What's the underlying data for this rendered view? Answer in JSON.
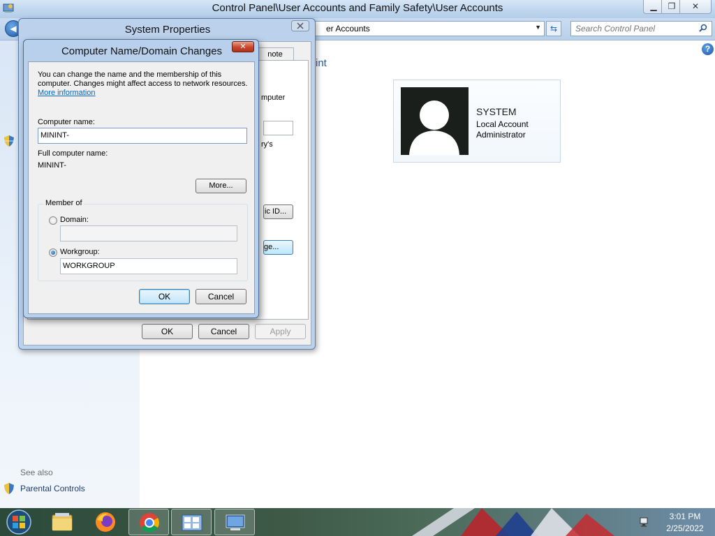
{
  "control_panel": {
    "title": "Control Panel\\User Accounts and Family Safety\\User Accounts",
    "address": "er Accounts",
    "search_placeholder": "Search Control Panel",
    "heading_partial": "int",
    "see_also": "See also",
    "parental_controls": "Parental Controls",
    "user": {
      "name": "SYSTEM",
      "account_type": "Local Account",
      "role": "Administrator"
    }
  },
  "system_properties": {
    "title": "System Properties",
    "tab_remote": "note",
    "text_computer": "mputer",
    "text_rys": "ry's",
    "network_id_button": "ic ID...",
    "change_button": "ge...",
    "ok": "OK",
    "cancel": "Cancel",
    "apply": "Apply"
  },
  "computer_name_dialog": {
    "title": "Computer Name/Domain Changes",
    "description": "You can change the name and the membership of this computer. Changes might affect access to network resources.",
    "more_information": "More information",
    "computer_name_label": "Computer name:",
    "computer_name_value": "MININT-",
    "full_name_label": "Full computer name:",
    "full_name_value": "MININT-",
    "more_button": "More...",
    "member_of_label": "Member of",
    "domain_label": "Domain:",
    "domain_value": "",
    "workgroup_label": "Workgroup:",
    "workgroup_value": "WORKGROUP",
    "selected_membership": "Workgroup",
    "ok": "OK",
    "cancel": "Cancel"
  },
  "taskbar": {
    "items": [
      "Windows Explorer",
      "Firefox",
      "Google Chrome",
      "Control Panel",
      "System Properties"
    ],
    "clock_time": "3:01 PM",
    "clock_date": "2/25/2022"
  },
  "colors": {
    "accent": "#1e5ca8",
    "link": "#0066cc",
    "close_red": "#c8452b"
  }
}
